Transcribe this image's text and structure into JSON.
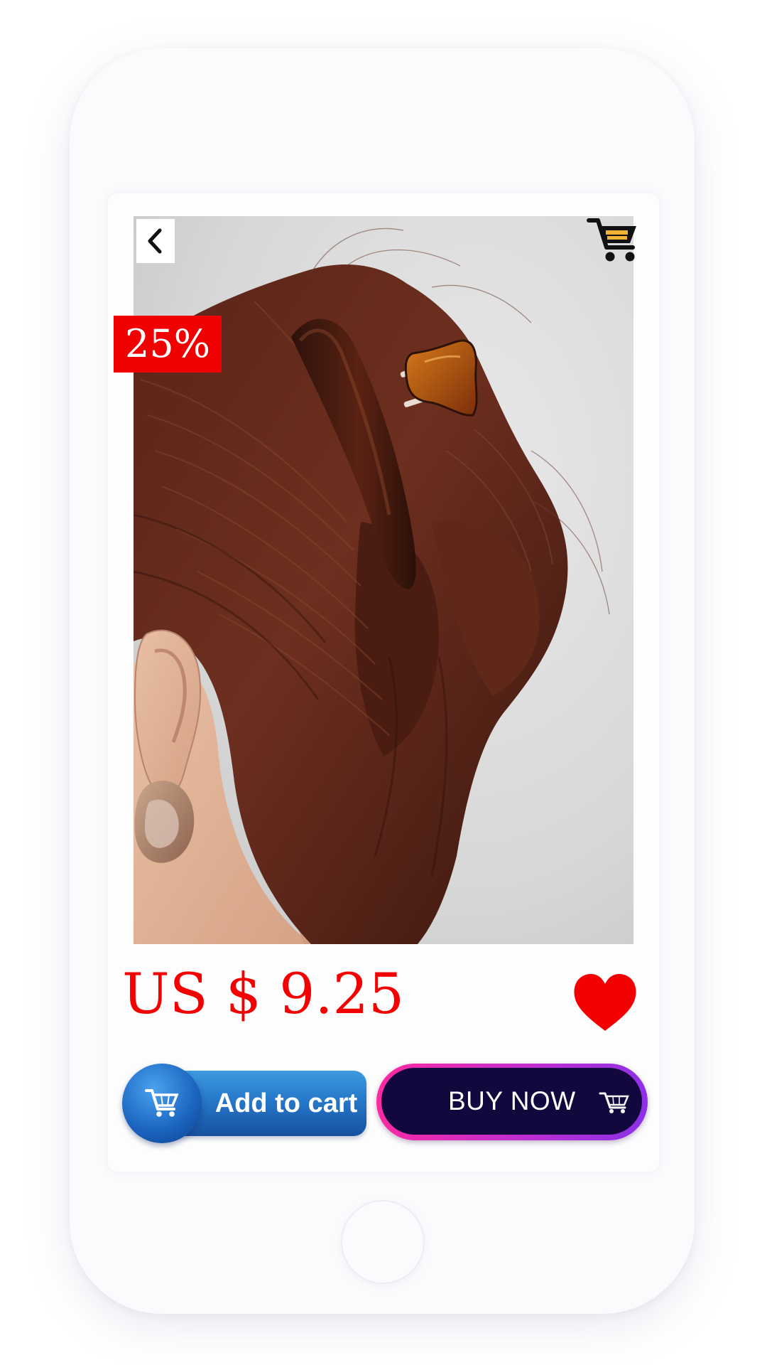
{
  "product": {
    "discount_badge": "25%",
    "price": "US $ 9.25",
    "image_subject": "woman-hair-claw-clip"
  },
  "actions": {
    "add_to_cart_label": "Add to cart",
    "buy_now_label": "BUY NOW"
  },
  "icons": {
    "back": "chevron-left-icon",
    "cart": "shopping-cart-icon",
    "favorite": "heart-icon"
  },
  "colors": {
    "price_red": "#f40000",
    "badge_red": "#f00000",
    "add_to_cart_blue": "#2576c7",
    "buy_now_bg": "#12083d",
    "buy_now_border": "#c02ed0"
  }
}
